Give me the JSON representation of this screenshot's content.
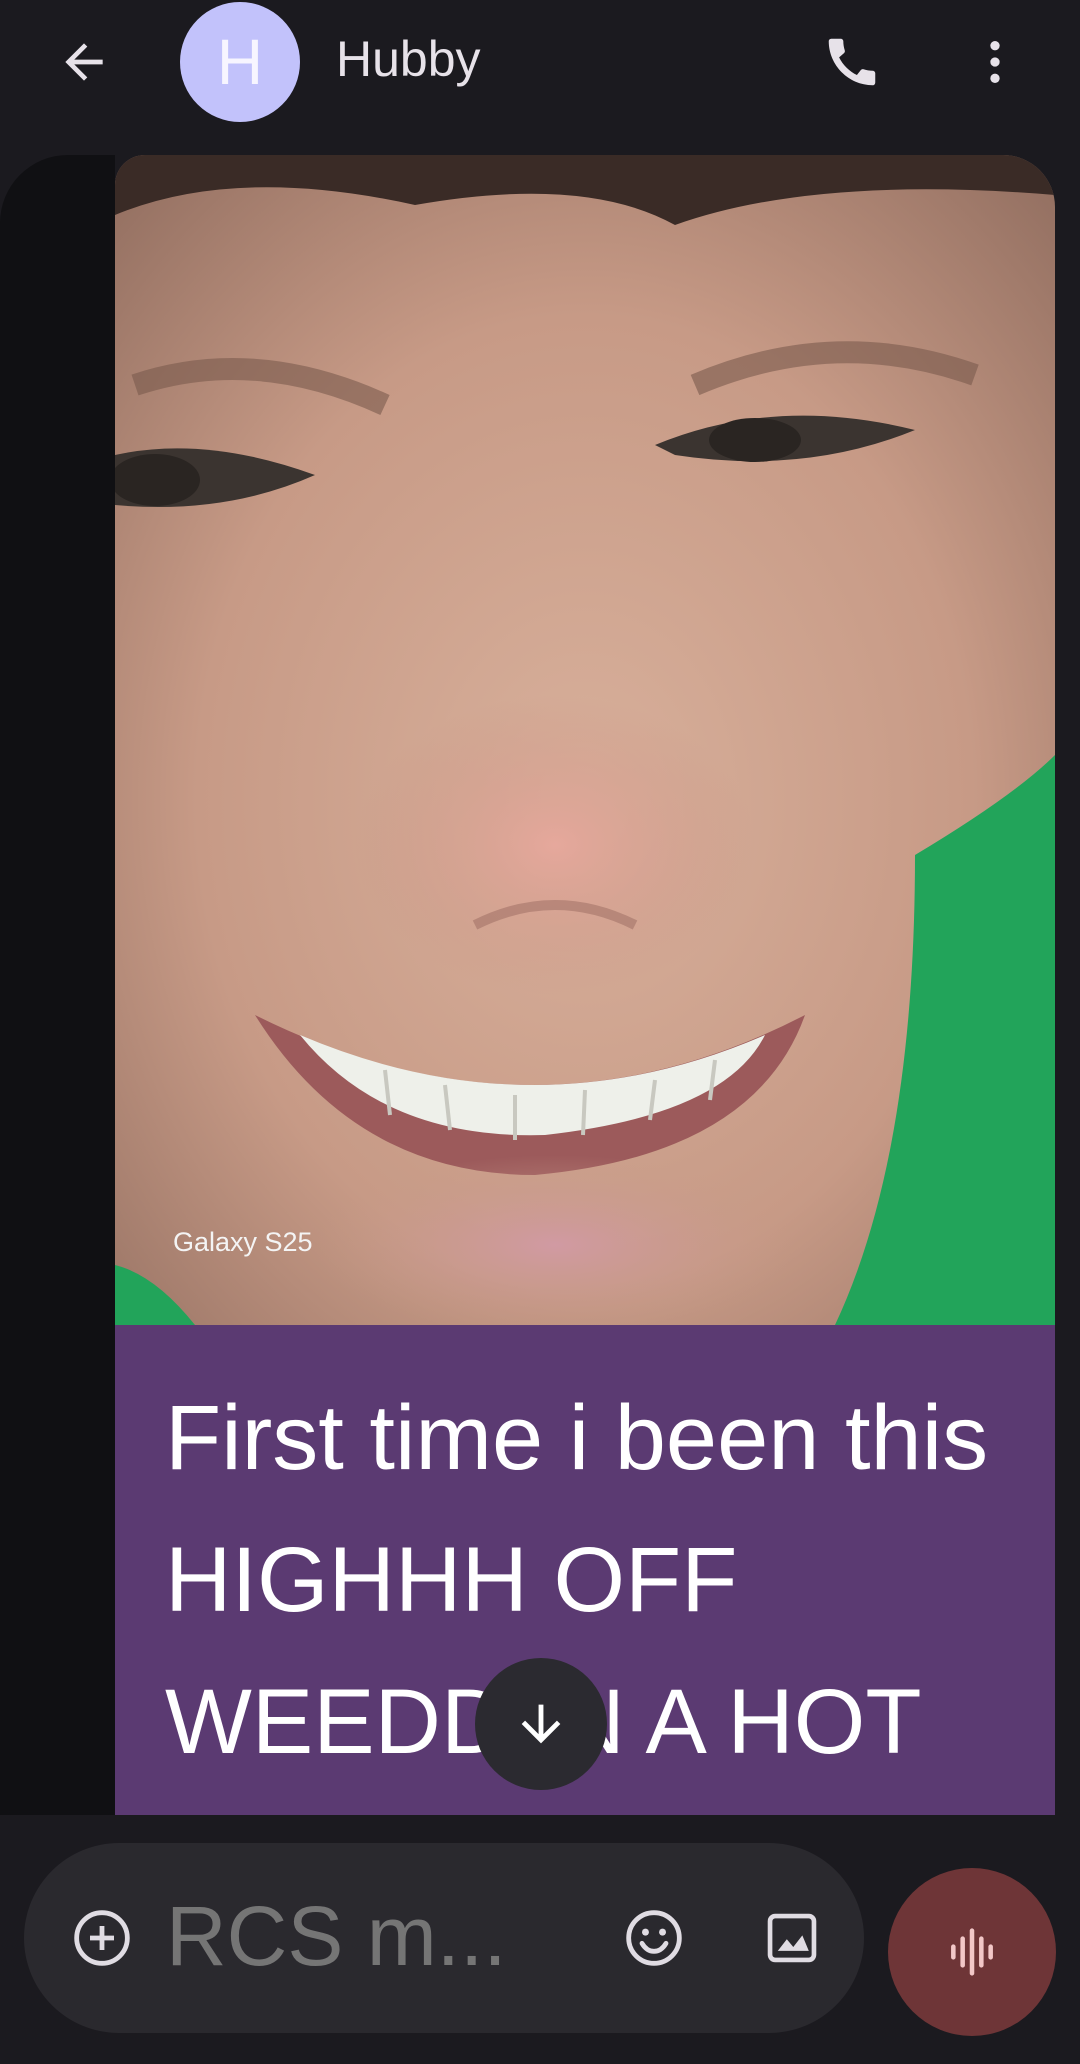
{
  "header": {
    "contact_name": "Hubby",
    "avatar_initial": "H",
    "avatar_color": "#c2c2fb"
  },
  "message": {
    "photo_watermark": "Galaxy S25",
    "caption": "First time i been this HIGHHH OFF WEEDD IN A HOT MIN. I HAVE NO",
    "bubble_color": "#5b3a72"
  },
  "composer": {
    "placeholder": "RCS m...",
    "voice_button_color": "#6e3537"
  },
  "icons": {
    "back": "arrow-left-icon",
    "call": "phone-icon",
    "more": "more-vert-icon",
    "scroll_down": "arrow-down-icon",
    "add": "add-circle-icon",
    "emoji": "emoji-icon",
    "gallery": "image-icon",
    "voice": "voice-waveform-icon"
  }
}
